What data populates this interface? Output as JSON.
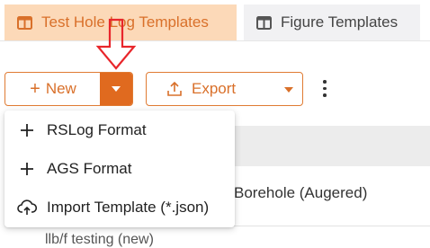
{
  "tabs": [
    {
      "label": "Test Hole Log Templates",
      "active": true
    },
    {
      "label": "Figure Templates",
      "active": false
    }
  ],
  "toolbar": {
    "new_label": "New",
    "export_label": "Export"
  },
  "dropdown_menu": {
    "items": [
      {
        "label": "RSLog Format",
        "icon": "plus-icon"
      },
      {
        "label": "AGS Format",
        "icon": "plus-icon"
      },
      {
        "label": "Import Template (*.json)",
        "icon": "cloud-upload-icon"
      }
    ]
  },
  "table": {
    "rows": [
      {
        "name": "Borehole (Augered)"
      },
      {
        "name": "llb/f testing (new)"
      }
    ]
  },
  "colors": {
    "accent": "#d9702a",
    "accent_dark": "#e06a1f",
    "active_tab_bg": "#fcd9b8",
    "annotation_arrow": "#e8262b"
  }
}
